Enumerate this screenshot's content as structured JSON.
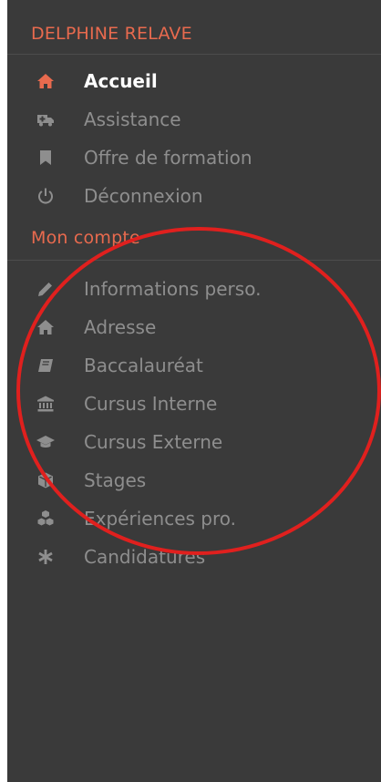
{
  "user": {
    "name": "DELPHINE RELAVE"
  },
  "nav": [
    {
      "label": "Accueil",
      "icon": "home-icon",
      "active": true
    },
    {
      "label": "Assistance",
      "icon": "ambulance-icon"
    },
    {
      "label": "Offre de formation",
      "icon": "bookmark-icon"
    },
    {
      "label": "Déconnexion",
      "icon": "power-icon"
    }
  ],
  "account": {
    "title": "Mon compte",
    "items": [
      {
        "label": "Informations perso.",
        "icon": "pencil-icon"
      },
      {
        "label": "Adresse",
        "icon": "home-icon"
      },
      {
        "label": "Baccalauréat",
        "icon": "book-icon"
      },
      {
        "label": "Cursus Interne",
        "icon": "university-icon"
      },
      {
        "label": "Cursus Externe",
        "icon": "graduation-cap-icon"
      },
      {
        "label": "Stages",
        "icon": "cube-icon"
      },
      {
        "label": "Expériences pro.",
        "icon": "cubes-icon"
      },
      {
        "label": "Candidatures",
        "icon": "asterisk-icon"
      }
    ]
  },
  "colors": {
    "accent": "#e86a4e",
    "sidebar_bg": "#3a3a3a",
    "text_muted": "#8e8e8e",
    "annotation": "#e0201e"
  }
}
